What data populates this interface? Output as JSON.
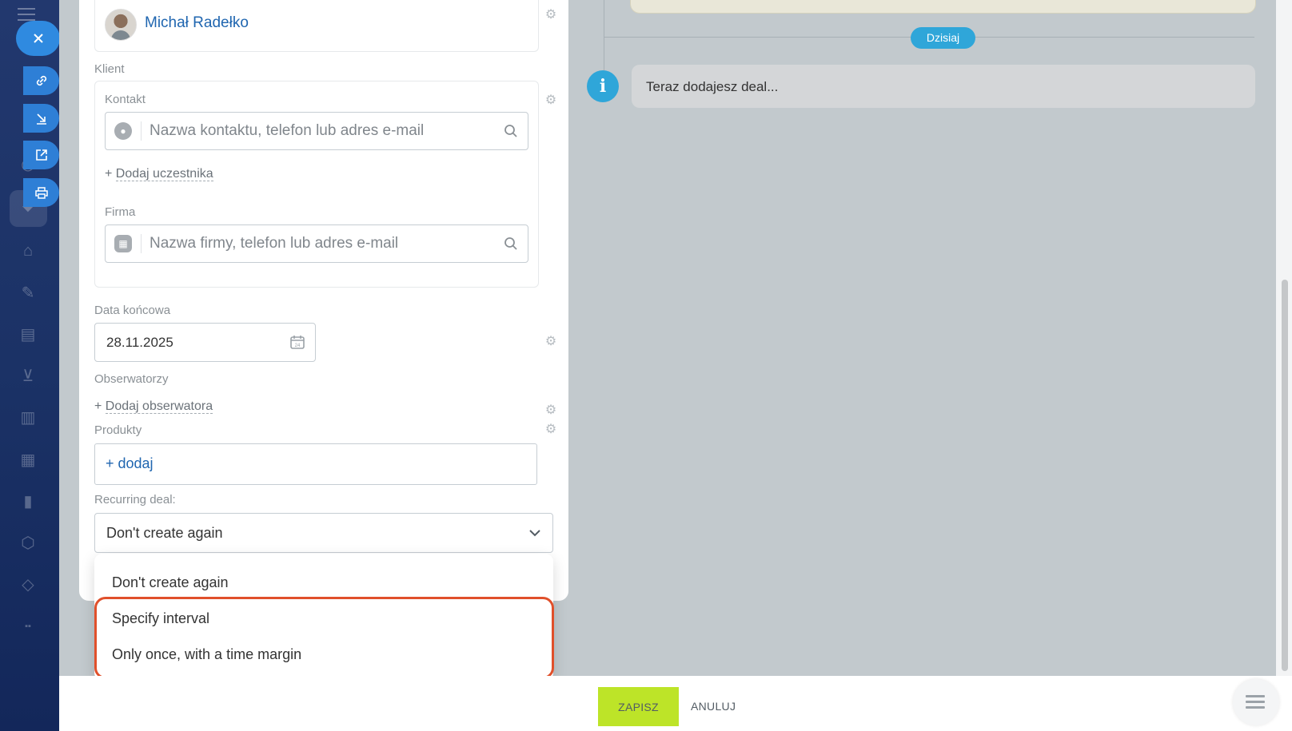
{
  "owner": {
    "name": "Michał Radełko"
  },
  "client": {
    "section_label": "Klient",
    "contact_label": "Kontakt",
    "contact_placeholder": "Nazwa kontaktu, telefon lub adres e-mail",
    "add_participant": "Dodaj uczestnika",
    "company_label": "Firma",
    "company_placeholder": "Nazwa firmy, telefon lub adres e-mail"
  },
  "close_date": {
    "label": "Data końcowa",
    "value": "28.11.2025",
    "calendar_day": "24"
  },
  "observers": {
    "label": "Obserwatorzy",
    "add": "Dodaj obserwatora"
  },
  "products": {
    "label": "Produkty",
    "add": "+ dodaj"
  },
  "recurring": {
    "label": "Recurring deal:",
    "selected": "Don't create again",
    "options": [
      "Don't create again",
      "Specify interval",
      "Only once, with a time margin"
    ]
  },
  "timeline": {
    "today": "Dzisiaj",
    "info_icon": "i",
    "info_text": "Teraz dodajesz deal..."
  },
  "actions": {
    "save": "ZAPISZ",
    "cancel": "ANULUJ"
  },
  "colors": {
    "save_button": "#bde428",
    "accent_blue": "#2fa6d9",
    "highlight": "#e0502b"
  }
}
